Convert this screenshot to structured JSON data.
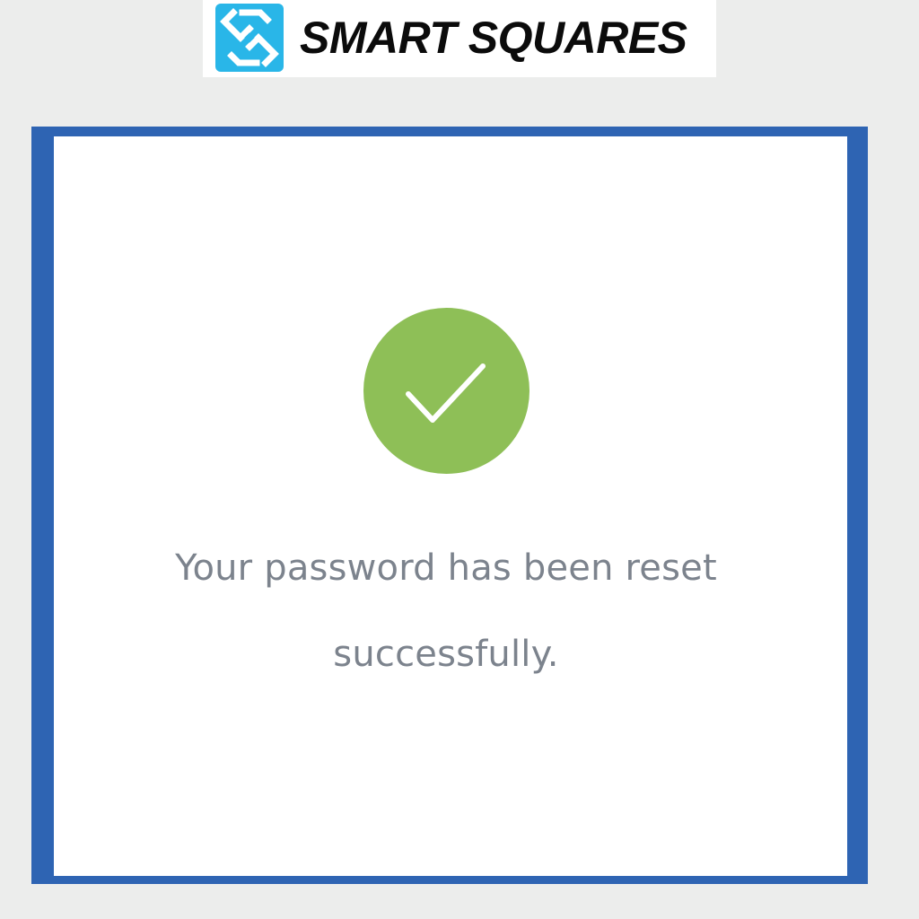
{
  "brand": {
    "name": "SMART SQUARES",
    "logo_icon": "smart-squares-logo-icon",
    "logo_color": "#29b6e8",
    "name_color": "#0b0b0b"
  },
  "card": {
    "frame_color": "#2e64b3",
    "status_icon": "checkmark-circle-icon",
    "status_color": "#8ebf57",
    "message_line_1": "Your password has been reset",
    "message_line_2": "successfully.",
    "message_color": "#7c838d"
  },
  "page": {
    "background_color": "#ecedec"
  }
}
